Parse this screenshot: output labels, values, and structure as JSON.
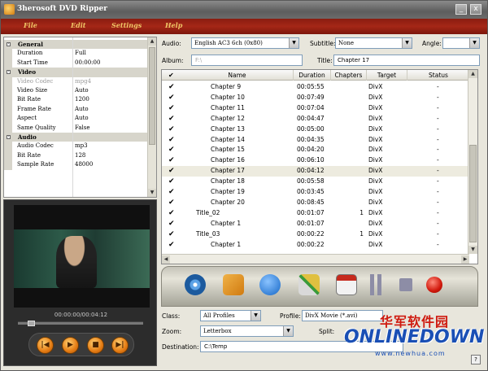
{
  "window": {
    "title": "3herosoft DVD Ripper",
    "minimize": "_",
    "close": "x"
  },
  "menu": [
    "File",
    "Edit",
    "Settings",
    "Help"
  ],
  "properties": [
    {
      "type": "category",
      "key": "General"
    },
    {
      "type": "row",
      "key": "Duration",
      "value": "Full"
    },
    {
      "type": "row",
      "key": "Start Time",
      "value": "00:00:00"
    },
    {
      "type": "category",
      "key": "Video"
    },
    {
      "type": "row",
      "key": "Video Codec",
      "value": "mpg4",
      "disabled": true
    },
    {
      "type": "row",
      "key": "Video Size",
      "value": "Auto"
    },
    {
      "type": "row",
      "key": "Bit Rate",
      "value": "1200"
    },
    {
      "type": "row",
      "key": "Frame Rate",
      "value": "Auto"
    },
    {
      "type": "row",
      "key": "Aspect",
      "value": "Auto"
    },
    {
      "type": "row",
      "key": "Same Quality",
      "value": "False"
    },
    {
      "type": "category",
      "key": "Audio"
    },
    {
      "type": "row",
      "key": "Audio Codec",
      "value": "mp3"
    },
    {
      "type": "row",
      "key": "Bit Rate",
      "value": "128"
    },
    {
      "type": "row",
      "key": "Sample Rate",
      "value": "48000"
    }
  ],
  "preview": {
    "timecode": "00:00:00/00:04:12",
    "seek_position": 0.08,
    "buttons": [
      "|◀",
      "▶",
      "■",
      "▶|"
    ]
  },
  "source": {
    "audio_label": "Audio:",
    "audio_value": "English AC3 6ch (0x80)",
    "subtitle_label": "Subtitle:",
    "subtitle_value": "None",
    "angle_label": "Angle:",
    "angle_value": "",
    "album_label": "Album:",
    "album_value": "F:\\",
    "title_label": "Title:",
    "title_value": "Chapter 17"
  },
  "list": {
    "columns": [
      "Name",
      "Duration",
      "Chapters",
      "Target",
      "Status"
    ],
    "check_all": "✔",
    "rows": [
      {
        "name": "Chapter 9",
        "duration": "00:05:55",
        "chapters": "",
        "target": "DivX",
        "status": "-",
        "level": 2
      },
      {
        "name": "Chapter 10",
        "duration": "00:07:49",
        "chapters": "",
        "target": "DivX",
        "status": "-",
        "level": 2
      },
      {
        "name": "Chapter 11",
        "duration": "00:07:04",
        "chapters": "",
        "target": "DivX",
        "status": "-",
        "level": 2
      },
      {
        "name": "Chapter 12",
        "duration": "00:04:47",
        "chapters": "",
        "target": "DivX",
        "status": "-",
        "level": 2
      },
      {
        "name": "Chapter 13",
        "duration": "00:05:00",
        "chapters": "",
        "target": "DivX",
        "status": "-",
        "level": 2
      },
      {
        "name": "Chapter 14",
        "duration": "00:04:35",
        "chapters": "",
        "target": "DivX",
        "status": "-",
        "level": 2
      },
      {
        "name": "Chapter 15",
        "duration": "00:04:20",
        "chapters": "",
        "target": "DivX",
        "status": "-",
        "level": 2
      },
      {
        "name": "Chapter 16",
        "duration": "00:06:10",
        "chapters": "",
        "target": "DivX",
        "status": "-",
        "level": 2
      },
      {
        "name": "Chapter 17",
        "duration": "00:04:12",
        "chapters": "",
        "target": "DivX",
        "status": "-",
        "level": 2,
        "selected": true
      },
      {
        "name": "Chapter 18",
        "duration": "00:05:58",
        "chapters": "",
        "target": "DivX",
        "status": "-",
        "level": 2
      },
      {
        "name": "Chapter 19",
        "duration": "00:03:45",
        "chapters": "",
        "target": "DivX",
        "status": "-",
        "level": 2
      },
      {
        "name": "Chapter 20",
        "duration": "00:08:45",
        "chapters": "",
        "target": "DivX",
        "status": "-",
        "level": 2
      },
      {
        "name": "Title_02",
        "duration": "00:01:07",
        "chapters": "1",
        "target": "DivX",
        "status": "-",
        "level": 1
      },
      {
        "name": "Chapter 1",
        "duration": "00:01:07",
        "chapters": "",
        "target": "DivX",
        "status": "-",
        "level": 2
      },
      {
        "name": "Title_03",
        "duration": "00:00:22",
        "chapters": "1",
        "target": "DivX",
        "status": "-",
        "level": 1
      },
      {
        "name": "Chapter 1",
        "duration": "00:00:22",
        "chapters": "",
        "target": "DivX",
        "status": "-",
        "level": 2
      }
    ]
  },
  "toolbar": [
    "open-dvd",
    "import",
    "settings",
    "clip",
    "log",
    "pause",
    "stop",
    "start"
  ],
  "output": {
    "class_label": "Class:",
    "class_value": "All Profiles",
    "profile_label": "Profile:",
    "profile_value": "DivX Movie (*.avi)",
    "zoom_label": "Zoom:",
    "zoom_value": "Letterbox",
    "split_label": "Split:",
    "destination_label": "Destination:",
    "destination_value": "C:\\Temp"
  },
  "watermark": {
    "cn": "华军软件园",
    "en": "ONLINEDOWN",
    "url": "www.newhua.com"
  },
  "help": "?"
}
